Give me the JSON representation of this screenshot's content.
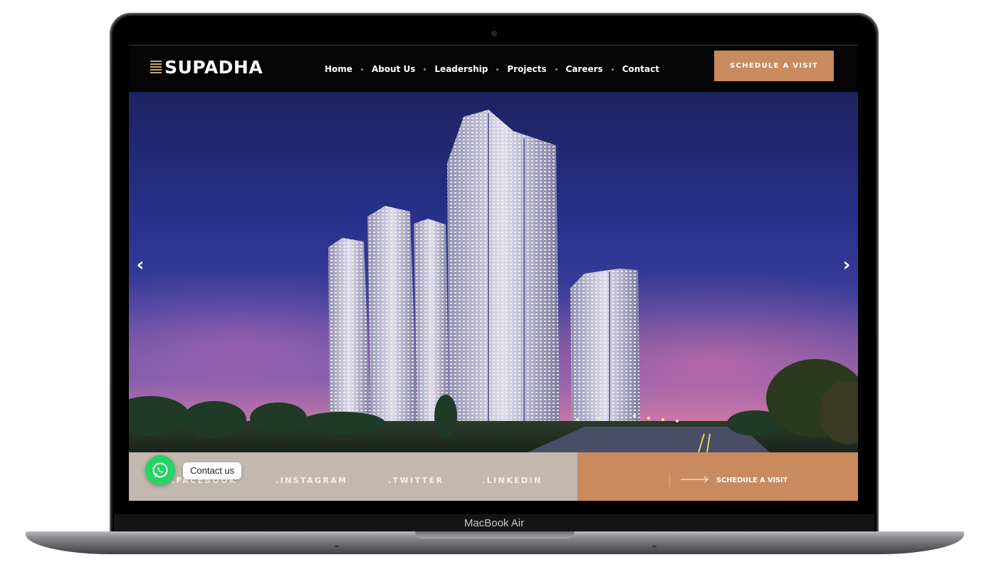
{
  "brand": {
    "name": "SUPADHA",
    "accent": "#c98a5e",
    "logo_stripe_color": "#c9a467"
  },
  "nav": {
    "items": [
      {
        "label": "Home"
      },
      {
        "label": "About Us"
      },
      {
        "label": "Leadership"
      },
      {
        "label": "Projects"
      },
      {
        "label": "Careers"
      },
      {
        "label": "Contact"
      }
    ],
    "separator_color": "#c8885a"
  },
  "header": {
    "cta_label": "SCHEDULE A VISIT"
  },
  "hero": {
    "prev_icon": "chevron-left-icon",
    "next_icon": "chevron-right-icon",
    "prev_glyph": "‹",
    "next_glyph": "›"
  },
  "social": {
    "links": [
      {
        "label": ".FACEBOOK"
      },
      {
        "label": ".INSTAGRAM"
      },
      {
        "label": ".TWITTER"
      },
      {
        "label": ".LINKEDIN"
      }
    ],
    "bar_color": "#c2b8ae"
  },
  "schedule": {
    "label": "SCHEDULE A VISIT",
    "icon": "long-arrow-right-icon"
  },
  "whatsapp": {
    "label": "Contact us",
    "icon": "whatsapp-icon",
    "color": "#25d366"
  },
  "device": {
    "label": "MacBook Air"
  }
}
